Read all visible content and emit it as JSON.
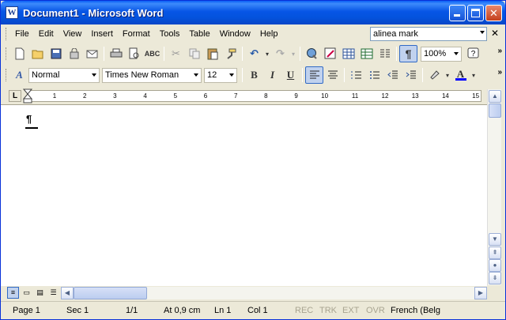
{
  "window": {
    "title": "Document1 - Microsoft Word",
    "app_icon_letter": "W"
  },
  "menu": {
    "items": [
      {
        "label": "File",
        "key": "F"
      },
      {
        "label": "Edit",
        "key": "E"
      },
      {
        "label": "View",
        "key": "V"
      },
      {
        "label": "Insert",
        "key": "I"
      },
      {
        "label": "Format",
        "key": "o"
      },
      {
        "label": "Tools",
        "key": "T"
      },
      {
        "label": "Table",
        "key": "a"
      },
      {
        "label": "Window",
        "key": "W"
      },
      {
        "label": "Help",
        "key": "H"
      }
    ],
    "help_box_value": "alinea mark"
  },
  "standard_toolbar": {
    "zoom": "100%",
    "buttons": [
      "new-icon",
      "open-icon",
      "save-icon",
      "permission-icon",
      "email-icon",
      "print-icon",
      "print-preview-icon",
      "spelling-icon",
      "cut-icon",
      "copy-icon",
      "paste-icon",
      "format-painter-icon",
      "undo-icon",
      "redo-icon",
      "hyperlink-icon",
      "tables-borders-icon",
      "insert-table-icon",
      "insert-excel-icon",
      "columns-icon",
      "show-hide-icon",
      "help-icon"
    ]
  },
  "formatting_toolbar": {
    "style": "Normal",
    "font": "Times New Roman",
    "size": "12",
    "bold": "B",
    "italic": "I",
    "underline": "U"
  },
  "ruler": {
    "marks": [
      "1",
      "2",
      "3",
      "4",
      "5",
      "6",
      "7",
      "8",
      "9",
      "10",
      "11",
      "12",
      "13",
      "14",
      "15"
    ],
    "tab_type": "L"
  },
  "document": {
    "text": "",
    "paragraph_mark": "¶"
  },
  "status": {
    "page": "Page 1",
    "section": "Sec 1",
    "page_of": "1/1",
    "at": "At 0,9 cm",
    "line": "Ln 1",
    "col": "Col 1",
    "rec": "REC",
    "trk": "TRK",
    "ext": "EXT",
    "ovr": "OVR",
    "language": "French (Belg"
  },
  "colors": {
    "title_bar": "#0755e6",
    "chrome": "#ece9d8",
    "highlight": "#c1d2ee",
    "font_color_underline": "#0000ff"
  }
}
